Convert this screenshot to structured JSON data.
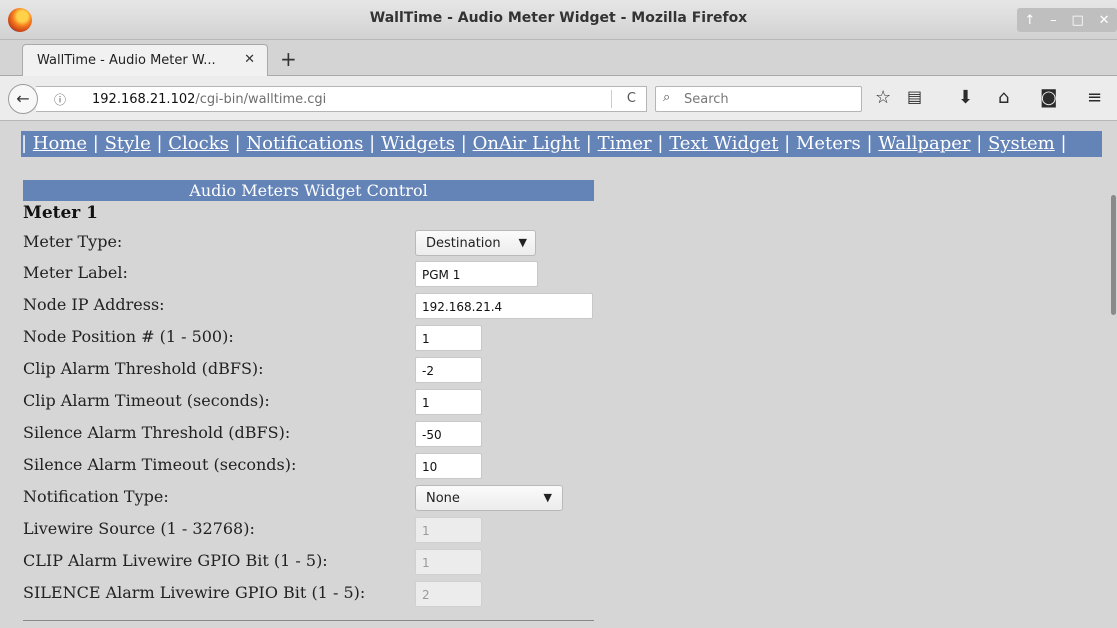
{
  "window": {
    "title": "WallTime - Audio Meter Widget - Mozilla Firefox",
    "controls": [
      "↑",
      "–",
      "□",
      "✕"
    ]
  },
  "tab": {
    "label": "WallTime - Audio Meter W...",
    "close": "✕",
    "new_tab": "+"
  },
  "navbar": {
    "back": "←",
    "info": "ⓘ",
    "url_host": "192.168.21.102",
    "url_path": "/cgi-bin/walltime.cgi",
    "reload": "C",
    "search_icon": "⌕",
    "search_placeholder": "Search",
    "icons": [
      "star-icon",
      "reading-list-icon",
      "download-icon",
      "home-icon",
      "pocket-icon",
      "menu-icon"
    ]
  },
  "nav_links": [
    {
      "label": "Home",
      "current": false
    },
    {
      "label": "Style",
      "current": false
    },
    {
      "label": "Clocks",
      "current": false
    },
    {
      "label": "Notifications",
      "current": false
    },
    {
      "label": "Widgets",
      "current": false
    },
    {
      "label": "OnAir Light",
      "current": false
    },
    {
      "label": "Timer",
      "current": false
    },
    {
      "label": "Text Widget",
      "current": false
    },
    {
      "label": "Meters",
      "current": true
    },
    {
      "label": "Wallpaper",
      "current": false
    },
    {
      "label": "System",
      "current": false
    }
  ],
  "section": {
    "header": "Audio Meters Widget Control",
    "meter_title": "Meter 1"
  },
  "form": {
    "meter_type": {
      "label": "Meter Type:",
      "value": "Destination"
    },
    "meter_label": {
      "label": "Meter Label:",
      "value": "PGM 1"
    },
    "node_ip": {
      "label": "Node IP Address:",
      "value": "192.168.21.4"
    },
    "node_position": {
      "label": "Node Position # (1 - 500):",
      "value": "1"
    },
    "clip_threshold": {
      "label": "Clip Alarm Threshold (dBFS):",
      "value": "-2"
    },
    "clip_timeout": {
      "label": "Clip Alarm Timeout (seconds):",
      "value": "1"
    },
    "silence_threshold": {
      "label": "Silence Alarm Threshold (dBFS):",
      "value": "-50"
    },
    "silence_timeout": {
      "label": "Silence Alarm Timeout (seconds):",
      "value": "10"
    },
    "notification_type": {
      "label": "Notification Type:",
      "value": "None"
    },
    "livewire_source": {
      "label": "Livewire Source (1 - 32768):",
      "value": "1"
    },
    "clip_gpio": {
      "label": "CLIP Alarm Livewire GPIO Bit (1 - 5):",
      "value": "1"
    },
    "silence_gpio": {
      "label": "SILENCE Alarm Livewire GPIO Bit (1 - 5):",
      "value": "2"
    }
  }
}
